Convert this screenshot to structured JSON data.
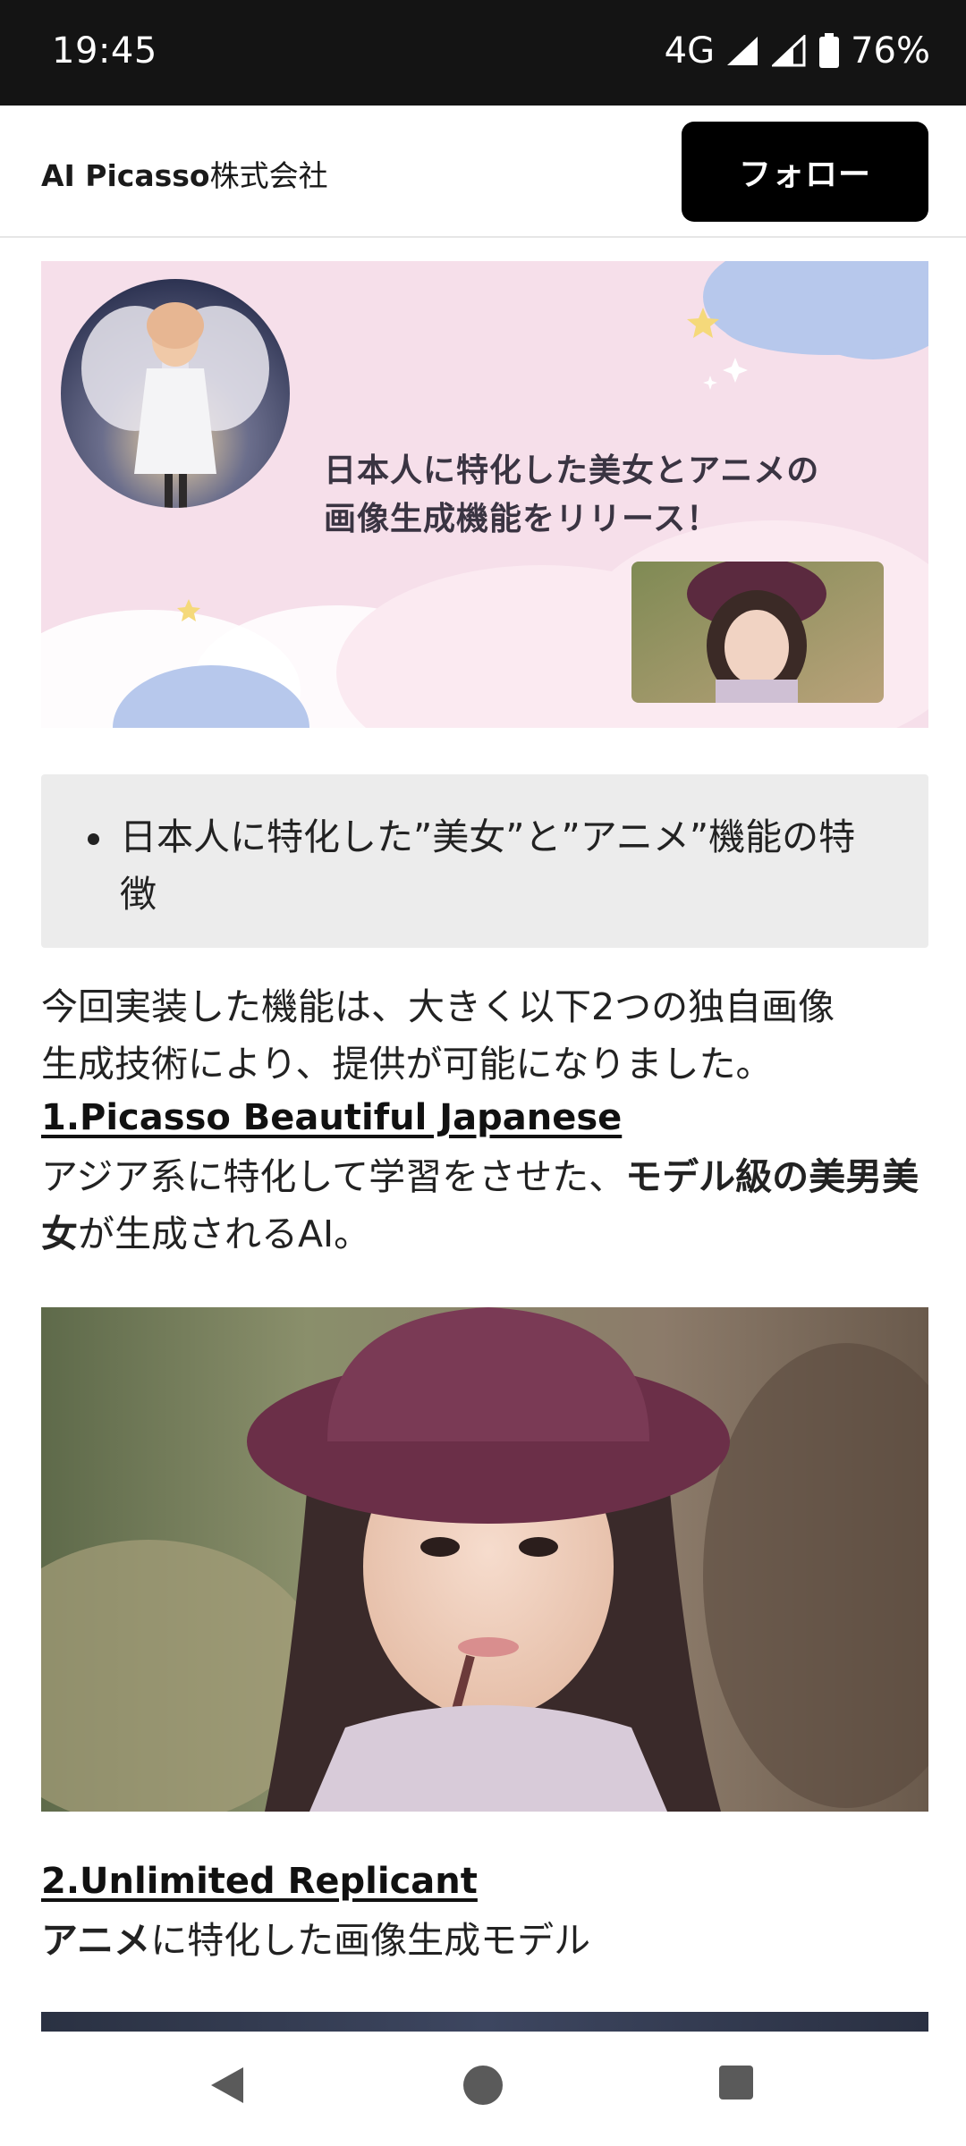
{
  "status_bar": {
    "time": "19:45",
    "network": "4G",
    "battery": "76%"
  },
  "header": {
    "account_name_latin": "AI Picasso",
    "account_name_cjk": "株式会社",
    "follow_label": "フォロー"
  },
  "banner": {
    "heading_line1": "日本人に特化した美女とアニメの",
    "heading_line2": "画像生成機能をリリース！"
  },
  "article": {
    "bullet_item": "日本人に特化した”美女”と”アニメ”機能の特徴",
    "intro_line1": "今回実装した機能は、大きく以下2つの独自画像",
    "intro_line2": "生成技術により、提供が可能になりました。",
    "section1_title": "1.Picasso Beautiful Japanese",
    "section1_text_pre": "アジア系に特化して学習をさせた、",
    "section1_text_bold": "モデル級の美男美女",
    "section1_text_post": "が生成されるAI。",
    "section2_title": "2.Unlimited Replicant",
    "section2_text_bold": "アニメ",
    "section2_text_post": "に特化した画像生成モデル"
  },
  "colors": {
    "banner_bg": "#f6dfea",
    "cloud_blue": "#b7c8ec",
    "follow_bg": "#000000",
    "bullet_box_bg": "#ececec"
  },
  "icons": [
    "signal-icon",
    "battery-icon",
    "back-icon",
    "home-icon",
    "recents-icon"
  ]
}
